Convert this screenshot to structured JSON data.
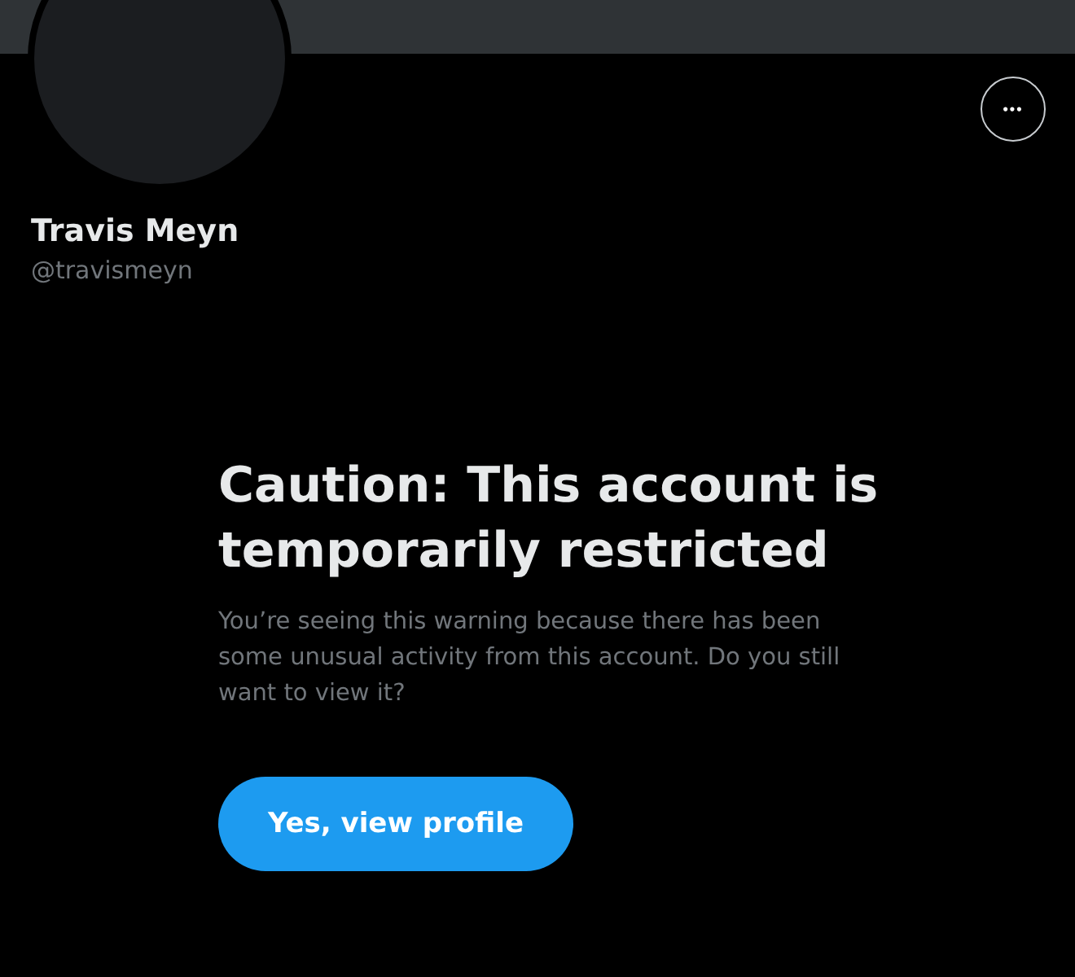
{
  "profile": {
    "name": "Travis Meyn",
    "handle": "@travismeyn",
    "more_button": "•••"
  },
  "warning": {
    "title": "Caution: This account is temporarily restricted",
    "message": "You’re seeing this warning because there has been some unusual activity from this account. Do you still want to view it?",
    "button": "Yes, view profile"
  }
}
